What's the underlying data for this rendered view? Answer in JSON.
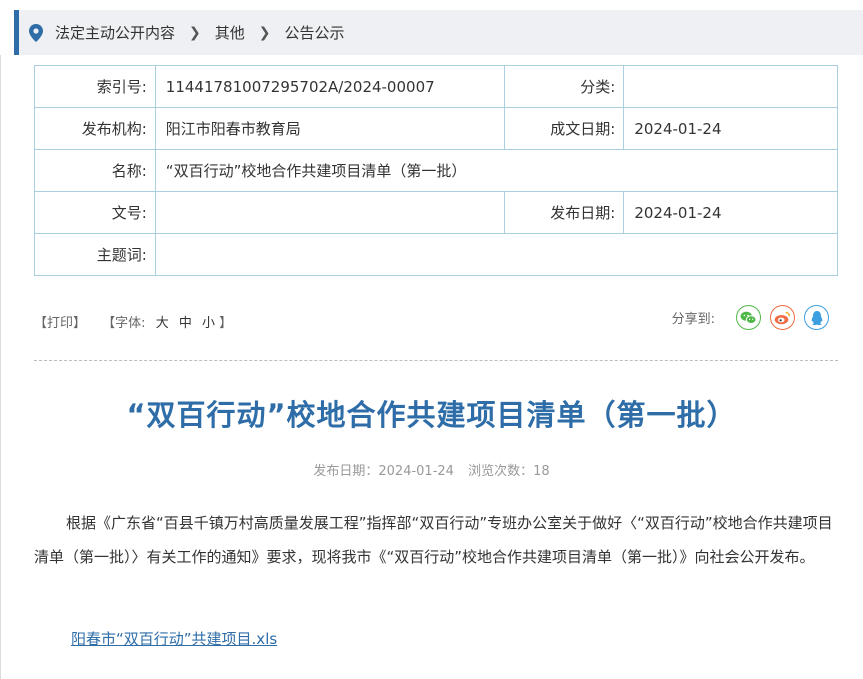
{
  "breadcrumb": {
    "items": [
      "法定主动公开内容",
      "其他",
      "公告公示"
    ]
  },
  "meta": {
    "index_label": "索引号:",
    "index_value": "11441781007295702A/2024-00007",
    "category_label": "分类:",
    "category_value": "",
    "publisher_label": "发布机构:",
    "publisher_value": "阳江市阳春市教育局",
    "created_label": "成文日期:",
    "created_value": "2024-01-24",
    "name_label": "名称:",
    "name_value": "“双百行动”校地合作共建项目清单（第一批）",
    "docno_label": "文号:",
    "docno_value": "",
    "pubdate_label": "发布日期:",
    "pubdate_value": "2024-01-24",
    "subject_label": "主题词:",
    "subject_value": ""
  },
  "tools": {
    "print": "【打印】",
    "font_prefix": "【字体:",
    "size_large": "大",
    "size_medium": "中",
    "size_small": "小",
    "font_suffix": "】",
    "share_label": "分享到:"
  },
  "share_icons": [
    "wechat-icon",
    "weibo-icon",
    "qq-icon"
  ],
  "colors": {
    "accent": "#2e6da8",
    "table_border": "#a9cfe0",
    "wechat": "#50b848",
    "weibo": "#ef6b45",
    "qq": "#3b9fe0"
  },
  "article": {
    "title": "“双百行动”校地合作共建项目清单（第一批）",
    "pub_label": "发布日期：",
    "pub_date": "2024-01-24",
    "views_label": "浏览次数：",
    "views": "18",
    "body": "根据《广东省“百县千镇万村高质量发展工程”指挥部“双百行动”专班办公室关于做好〈“双百行动”校地合作共建项目清单（第一批）〉有关工作的通知》要求，现将我市《“双百行动”校地合作共建项目清单（第一批）》向社会公开发布。",
    "attachment": "阳春市“双百行动”共建项目.xls"
  }
}
